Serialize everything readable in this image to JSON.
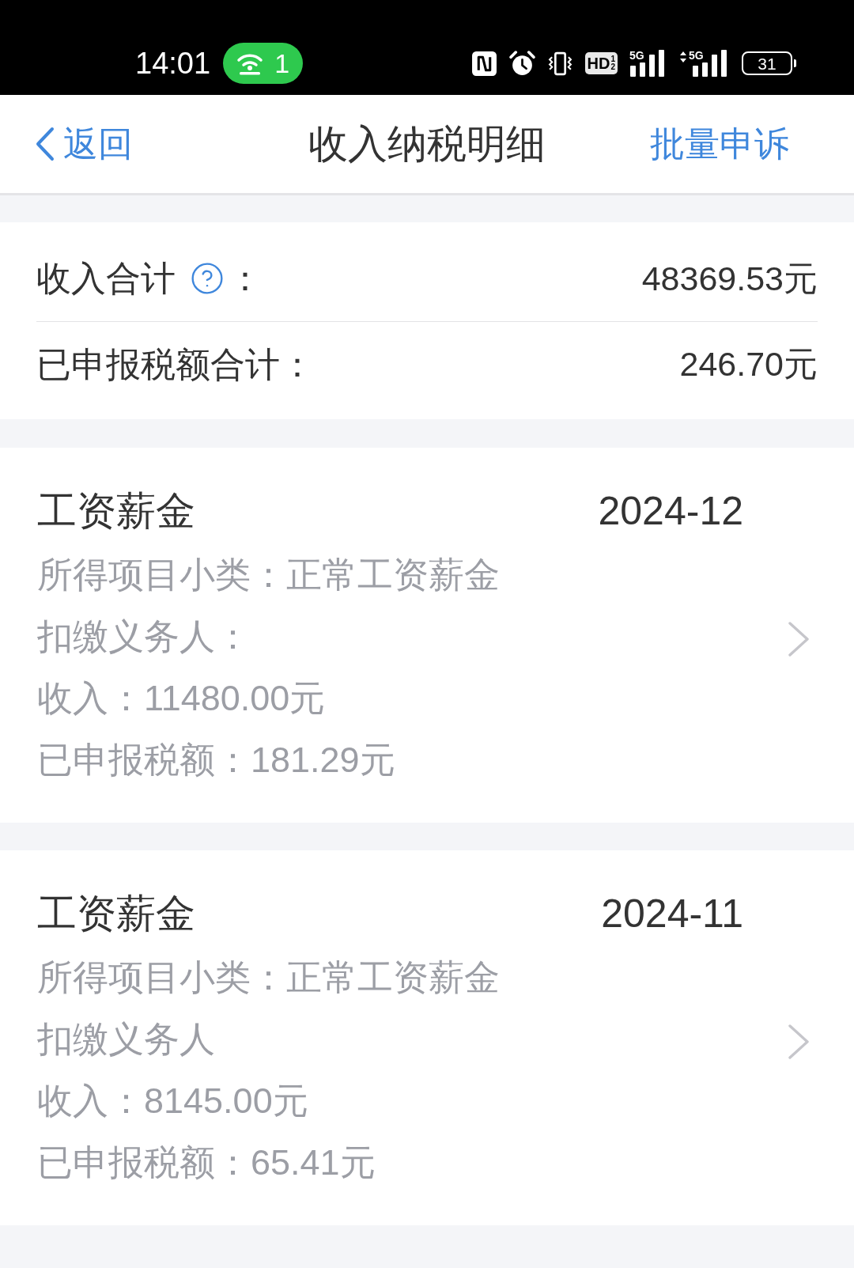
{
  "status_bar": {
    "time": "14:01",
    "hotspot_count": "1",
    "hd_label": "HD",
    "hd_slots": [
      "1",
      "2"
    ],
    "signals": [
      {
        "label": "5G",
        "transfer": false
      },
      {
        "label": "5G",
        "transfer": true
      }
    ],
    "battery": "31"
  },
  "nav": {
    "back": "返回",
    "title": "收入纳税明细",
    "action": "批量申诉"
  },
  "summary": {
    "rows": [
      {
        "label": "收入合计",
        "help": true,
        "colon": "：",
        "value": "48369.53元"
      },
      {
        "label": "已申报税额合计",
        "help": false,
        "colon": "：",
        "value": "246.70元"
      }
    ]
  },
  "records": [
    {
      "category": "工资薪金",
      "period": "2024-12",
      "lines": [
        "所得项目小类：正常工资薪金",
        "扣缴义务人：",
        "收入：11480.00元",
        "已申报税额：181.29元"
      ]
    },
    {
      "category": "工资薪金",
      "period": "2024-11",
      "lines": [
        "所得项目小类：正常工资薪金",
        "扣缴义务人",
        "收入：8145.00元",
        "已申报税额：65.41元"
      ]
    }
  ]
}
